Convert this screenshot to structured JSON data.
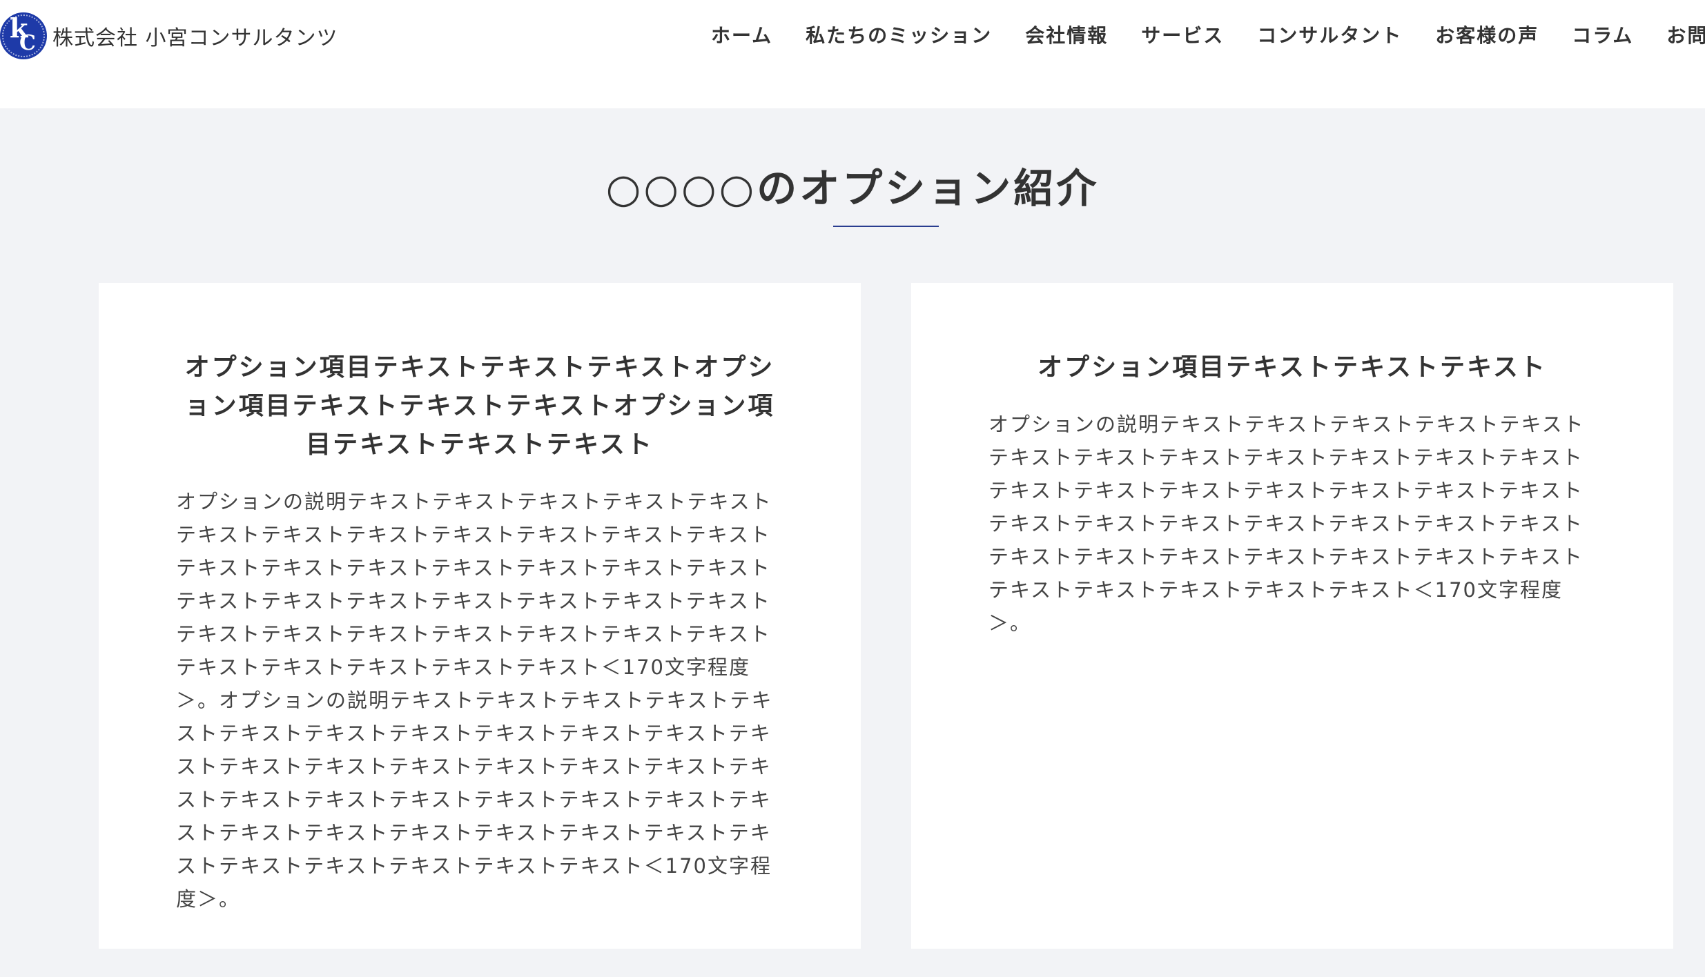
{
  "header": {
    "logo_mark_k": "k",
    "logo_mark_c": "C",
    "company_name": "株式会社 小宮コンサルタンツ",
    "nav": [
      {
        "label": "ホーム"
      },
      {
        "label": "私たちのミッション"
      },
      {
        "label": "会社情報"
      },
      {
        "label": "サービス"
      },
      {
        "label": "コンサルタント"
      },
      {
        "label": "お客様の声"
      },
      {
        "label": "コラム"
      },
      {
        "label": "お問い"
      }
    ]
  },
  "section": {
    "title": "○○○○のオプション紹介"
  },
  "cards": [
    {
      "title": "オプション項目テキストテキストテキストオプション項目テキストテキストテキストオプション項目テキストテキストテキスト",
      "body": "オプションの説明テキストテキストテキストテキストテキストテキストテキストテキストテキストテキストテキストテキストテキストテキストテキストテキストテキストテキストテキストテキストテキストテキストテキストテキストテキストテキストテキストテキストテキストテキストテキストテキストテキストテキストテキストテキストテキストテキスト＜170文字程度＞。オプションの説明テキストテキストテキストテキストテキストテキストテキストテキストテキストテキストテキストテキストテキストテキストテキストテキストテキストテキストテキストテキストテキストテキストテキストテキストテキストテキストテキストテキストテキストテキストテキストテキストテキストテキストテキストテキストテキストテキスト＜170文字程度＞。"
    },
    {
      "title": "オプション項目テキストテキストテキスト",
      "body": "オプションの説明テキストテキストテキストテキストテキストテキストテキストテキストテキストテキストテキストテキストテキストテキストテキストテキストテキストテキストテキストテキストテキストテキストテキストテキストテキストテキストテキストテキストテキストテキストテキストテキストテキストテキストテキストテキストテキストテキスト＜170文字程度＞。"
    }
  ]
}
